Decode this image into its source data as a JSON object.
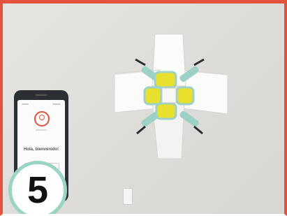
{
  "step": {
    "number": "5"
  },
  "phone": {
    "greeting": "Hola, bienvenido!"
  },
  "colors": {
    "border": "#e2523d",
    "wall": "#e0deda",
    "panel": "#fbfbfa",
    "pad": "#e8df2e",
    "arm": "#9ed1c5",
    "badge_ring": "#9ad4c4"
  },
  "icons": [
    "user-icon",
    "pan-tilt-device-icon"
  ]
}
